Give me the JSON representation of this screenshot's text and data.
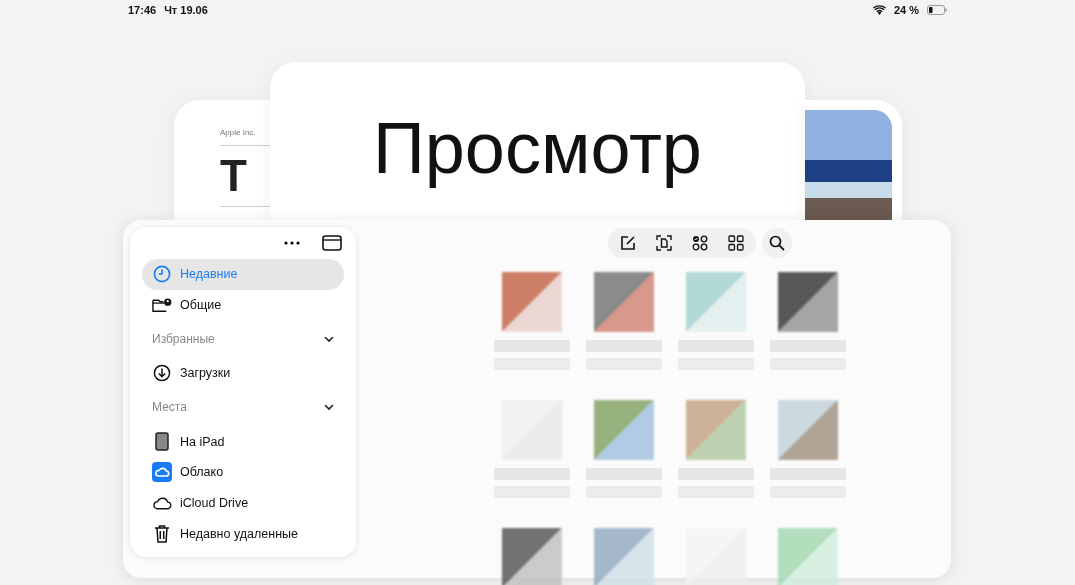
{
  "status_bar": {
    "time": "17:46",
    "date": "Чт 19.06",
    "battery_text": "24 %"
  },
  "background_cards": [
    {
      "kind": "document",
      "header": "Apple Inc.",
      "title": "T"
    },
    {
      "kind": "title",
      "title": "Просмотр"
    },
    {
      "kind": "photo"
    }
  ],
  "sidebar": {
    "sections": [
      {
        "items": [
          {
            "label": "Недавние",
            "selected": true
          },
          {
            "label": "Общие",
            "selected": false
          }
        ]
      },
      {
        "heading": "Избранные",
        "expanded": true,
        "items": [
          {
            "label": "Загрузки",
            "selected": false
          }
        ]
      },
      {
        "heading": "Места",
        "expanded": true,
        "items": [
          {
            "label": "На iPad",
            "selected": false
          },
          {
            "label": "Облако",
            "selected": false
          },
          {
            "label": "iCloud Drive",
            "selected": false
          },
          {
            "label": "Недавно удаленные",
            "selected": false
          }
        ]
      }
    ]
  }
}
